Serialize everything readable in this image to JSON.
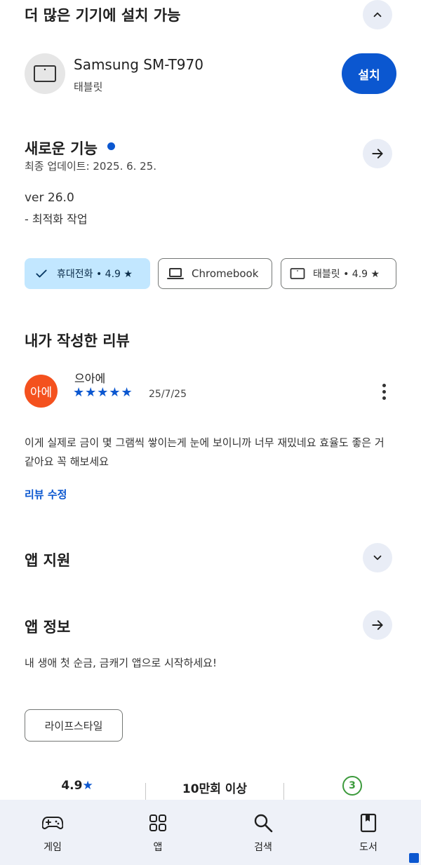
{
  "devices": {
    "title": "더 많은 기기에 설치 가능",
    "device_name": "Samsung SM-T970",
    "device_type": "태블릿",
    "install_label": "설치"
  },
  "whats_new": {
    "title": "새로운 기능",
    "updated": "최종 업데이트: 2025. 6. 25.",
    "version": "ver 26.0",
    "note": "- 최적화 작업"
  },
  "chips": [
    {
      "label": "휴대전화 • 4.9 ★",
      "selected": true
    },
    {
      "label": "Chromebook",
      "selected": false
    },
    {
      "label": "태블릿 • 4.9 ★",
      "selected": false
    }
  ],
  "review": {
    "section_title": "내가 작성한 리뷰",
    "avatar_text": "아에",
    "author": "으아에",
    "stars": "★★★★★",
    "rating": 5,
    "date": "25/7/25",
    "body": "이게 실제로 금이 몇 그램씩 쌓이는게 눈에 보이니까 너무 재밌네요 효율도 좋은 거 같아요 꼭 해보세요",
    "edit_label": "리뷰 수정"
  },
  "app_support": {
    "title": "앱 지원"
  },
  "app_info": {
    "title": "앱 정보",
    "description": "내 생애 첫 순금, 금캐기 앱으로 시작하세요!",
    "category": "라이프스타일"
  },
  "stats": {
    "rating": "4.9",
    "rating_star": "★",
    "downloads": "10만회 이상",
    "age": "3"
  },
  "nav": [
    {
      "label": "게임",
      "icon": "gamepad-icon"
    },
    {
      "label": "앱",
      "icon": "apps-grid-icon"
    },
    {
      "label": "검색",
      "icon": "search-icon"
    },
    {
      "label": "도서",
      "icon": "book-icon"
    }
  ],
  "colors": {
    "accent": "#0b57d0",
    "chip_selected": "#c2e7ff",
    "avatar": "#f4511e",
    "age_badge": "#3c9a3c"
  }
}
